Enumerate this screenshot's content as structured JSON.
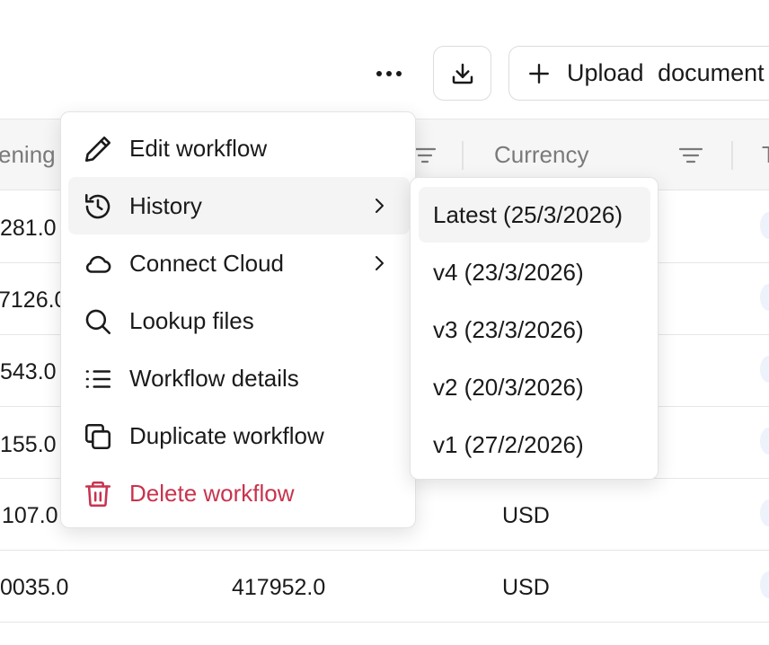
{
  "toolbar": {
    "more_icon": "more-horizontal-icon",
    "download_icon": "download-icon",
    "upload_label": "Upload  document",
    "upload_icon": "plus-icon"
  },
  "table": {
    "headers": [
      "ening",
      "Currency",
      "T"
    ],
    "rows": [
      [
        "281.0",
        "",
        ""
      ],
      [
        "7126.0",
        "",
        ""
      ],
      [
        "543.0",
        "",
        ""
      ],
      [
        "155.0",
        "",
        ""
      ],
      [
        "107.0",
        "",
        "USD"
      ],
      [
        "0035.0",
        "417952.0",
        "USD"
      ]
    ]
  },
  "menu": {
    "items": [
      {
        "label": "Edit workflow",
        "icon": "pencil-icon"
      },
      {
        "label": "History",
        "icon": "history-icon",
        "submenu": true
      },
      {
        "label": "Connect Cloud",
        "icon": "cloud-icon",
        "submenu": true
      },
      {
        "label": "Lookup files",
        "icon": "search-icon"
      },
      {
        "label": "Workflow details",
        "icon": "list-icon"
      },
      {
        "label": "Duplicate workflow",
        "icon": "copy-icon"
      },
      {
        "label": "Delete workflow",
        "icon": "trash-icon",
        "danger": true
      }
    ]
  },
  "history_submenu": {
    "items": [
      {
        "label": "Latest (25/3/2026)"
      },
      {
        "label": "v4 (23/3/2026)"
      },
      {
        "label": "v3 (23/3/2026)"
      },
      {
        "label": "v2 (20/3/2026)"
      },
      {
        "label": "v1 (27/2/2026)"
      }
    ]
  },
  "colors": {
    "danger": "#c8334e",
    "hover": "#f4f4f5",
    "header_bg": "#f6f6f7"
  }
}
